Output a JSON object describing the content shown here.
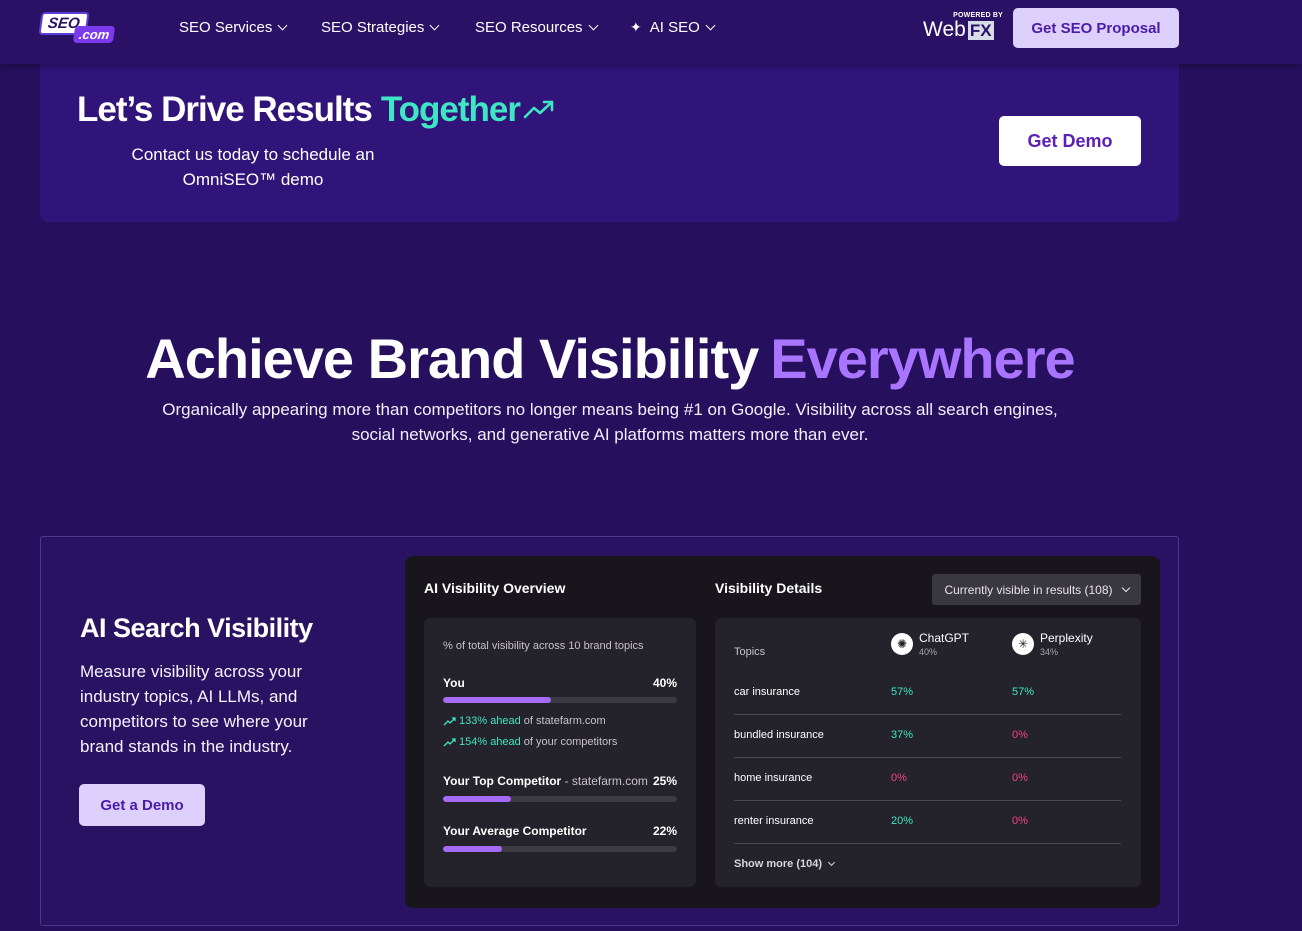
{
  "nav": {
    "logo_main": "SEO",
    "logo_suffix": ".com",
    "items": [
      {
        "label": "SEO Services"
      },
      {
        "label": "SEO Strategies"
      },
      {
        "label": "SEO Resources"
      },
      {
        "label": "AI SEO",
        "icon": "sparkle-icon"
      }
    ],
    "powered_by": "POWERED BY",
    "powered_brand": "Web",
    "powered_brand_fx": "FX",
    "cta_label": "Get SEO Proposal"
  },
  "cta": {
    "title_main": "Let’s Drive Results",
    "title_accent": "Together",
    "subtitle": "Contact us today to schedule an OmniSEO™ demo",
    "button_label": "Get Demo"
  },
  "hero": {
    "title_main": "Achieve Brand Visibility",
    "title_accent": "Everywhere",
    "subtitle": "Organically appearing more than competitors no longer means being #1 on Google. Visibility across all search engines, social networks, and generative AI platforms matters more than ever."
  },
  "feature": {
    "title": "AI Search Visibility",
    "description": "Measure visibility across your industry topics, AI LLMs, and competitors to see where your brand stands in the industry.",
    "button_label": "Get a Demo"
  },
  "dashboard": {
    "overview_title": "AI Visibility Overview",
    "details_title": "Visibility Details",
    "filter_label": "Currently visible in results (108)",
    "overview": {
      "note": "% of total visibility across 10 brand topics",
      "you_label": "You",
      "you_value": "40%",
      "you_fill": 0.46,
      "ahead_1_value": "133% ahead",
      "ahead_1_rest": "of statefarm.com",
      "ahead_2_value": "154% ahead",
      "ahead_2_rest": "of your competitors",
      "top_label": "Your Top Competitor",
      "top_domain": "- statefarm.com",
      "top_value": "25%",
      "top_fill": 0.29,
      "avg_label": "Your Average Competitor",
      "avg_value": "22%",
      "avg_fill": 0.25
    },
    "details": {
      "topics_header": "Topics",
      "engines": [
        {
          "name": "ChatGPT",
          "pct": "40%"
        },
        {
          "name": "Perplexity",
          "pct": "34%"
        }
      ],
      "rows": [
        {
          "topic": "car insurance",
          "chatgpt": "57%",
          "perplexity": "57%"
        },
        {
          "topic": "bundled insurance",
          "chatgpt": "37%",
          "perplexity": "0%"
        },
        {
          "topic": "home insurance",
          "chatgpt": "0%",
          "perplexity": "0%"
        },
        {
          "topic": "renter insurance",
          "chatgpt": "20%",
          "perplexity": "0%"
        }
      ],
      "show_more": "Show more (104)"
    }
  },
  "colors": {
    "background": "#26105e",
    "accent_teal": "#3ee6c4",
    "accent_purple": "#a974ff",
    "negative": "#f2447c"
  }
}
